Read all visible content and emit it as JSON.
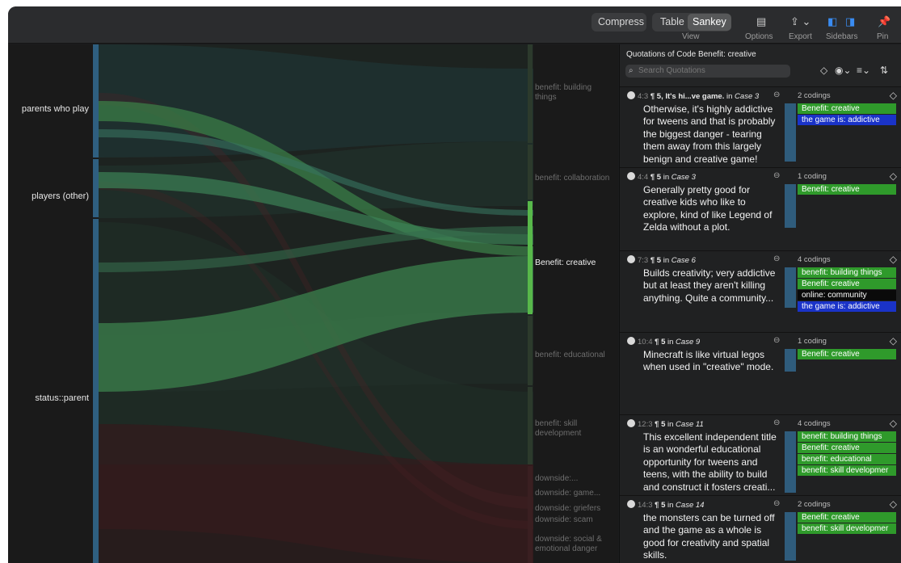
{
  "toolbar": {
    "compress": "Compress",
    "table": "Table",
    "sankey": "Sankey",
    "view_caption": "View",
    "options_caption": "Options",
    "export_caption": "Export",
    "sidebars_caption": "Sidebars",
    "pin_caption": "Pin",
    "icons": [
      "options-icon",
      "export-icon",
      "sidebar-left-icon",
      "sidebar-right-icon",
      "pin-icon"
    ]
  },
  "sankey": {
    "sources": [
      "parents who play",
      "players (other)",
      "status::parent"
    ],
    "targets": [
      {
        "label": "benefit: building things",
        "active": false
      },
      {
        "label": "benefit: collaboration",
        "active": false
      },
      {
        "label": "Benefit: creative",
        "active": true
      },
      {
        "label": "benefit: educational",
        "active": false
      },
      {
        "label": "benefit: skill development",
        "active": false
      },
      {
        "label": "downside:...",
        "active": false
      },
      {
        "label": "downside: game...",
        "active": false
      },
      {
        "label": "downside: griefers",
        "active": false
      },
      {
        "label": "downside: scam",
        "active": false
      },
      {
        "label": "downside: social & emotional danger",
        "active": false
      }
    ],
    "colors": {
      "source": "#2f5f80",
      "flow_highlight": "#3f8a40",
      "target_active": "#58b84a",
      "downside": "#6b2022"
    }
  },
  "panel": {
    "title": "Quotations of Code Benefit: creative",
    "search_placeholder": "Search Quotations",
    "cards": [
      {
        "ref": "4:3",
        "title": "¶ 5, It's hi...ve game.",
        "in": "in",
        "case": "Case 3",
        "body": "Otherwise, it's highly addictive for tweens and that is probably the biggest danger - tearing them away from this largely benign and creative game!",
        "count": "2 codings",
        "codes": [
          {
            "label": "Benefit: creative",
            "color": "green"
          },
          {
            "label": "the game is: addictive",
            "color": "blue"
          }
        ]
      },
      {
        "ref": "4:4",
        "title": "¶ 5",
        "in": "in",
        "case": "Case 3",
        "body": "Generally pretty good for creative kids who like to explore, kind of like Legend of Zelda without a plot.",
        "count": "1 coding",
        "codes": [
          {
            "label": "Benefit: creative",
            "color": "green"
          }
        ]
      },
      {
        "ref": "7:3",
        "title": "¶ 5",
        "in": "in",
        "case": "Case 6",
        "body": "Builds creativity; very addictive but at least they aren't killing anything. Quite a community...",
        "count": "4 codings",
        "codes": [
          {
            "label": "benefit: building things",
            "color": "green"
          },
          {
            "label": "Benefit: creative",
            "color": "green"
          },
          {
            "label": "online: community",
            "color": "black"
          },
          {
            "label": "the game is: addictive",
            "color": "blue"
          }
        ]
      },
      {
        "ref": "10:4",
        "title": "¶ 5",
        "in": "in",
        "case": "Case 9",
        "body": "Minecraft is like virtual legos when used in \"creative\" mode.",
        "count": "1 coding",
        "codes": [
          {
            "label": "Benefit: creative",
            "color": "green"
          }
        ]
      },
      {
        "ref": "12:3",
        "title": "¶ 5",
        "in": "in",
        "case": "Case 11",
        "body": "This excellent independent title is an wonderful educational opportunity for tweens and teens, with the ability to build and construct it fosters creati...",
        "count": "4 codings",
        "codes": [
          {
            "label": "benefit: building things",
            "color": "green"
          },
          {
            "label": "Benefit: creative",
            "color": "green"
          },
          {
            "label": "benefit: educational",
            "color": "green"
          },
          {
            "label": "benefit: skill developmer",
            "color": "green"
          }
        ]
      },
      {
        "ref": "14:3",
        "title": "¶ 5",
        "in": "in",
        "case": "Case 14",
        "body": "the monsters can be turned off and the game as a whole is good for creativity and spatial skills.",
        "count": "2 codings",
        "codes": [
          {
            "label": "Benefit: creative",
            "color": "green"
          },
          {
            "label": "benefit: skill developmer",
            "color": "green"
          }
        ]
      }
    ]
  }
}
